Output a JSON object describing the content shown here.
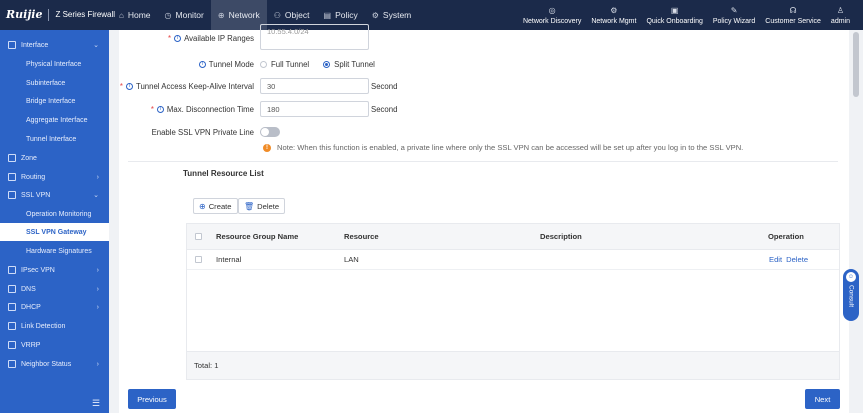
{
  "header": {
    "logo": "Ruijie",
    "series": "Z Series Firewall",
    "nav": [
      {
        "label": "Home",
        "icon": "home-icon"
      },
      {
        "label": "Monitor",
        "icon": "monitor-icon"
      },
      {
        "label": "Network",
        "icon": "network-icon"
      },
      {
        "label": "Object",
        "icon": "object-icon"
      },
      {
        "label": "Policy",
        "icon": "policy-icon"
      },
      {
        "label": "System",
        "icon": "system-icon"
      }
    ],
    "tools": [
      {
        "label": "Network Discovery",
        "icon": "network-discovery-icon"
      },
      {
        "label": "Network Mgmt",
        "icon": "network-mgmt-icon"
      },
      {
        "label": "Quick Onboarding",
        "icon": "quick-onboarding-icon"
      },
      {
        "label": "Policy Wizard",
        "icon": "policy-wizard-icon"
      },
      {
        "label": "Customer Service",
        "icon": "headset-icon"
      },
      {
        "label": "admin",
        "icon": "user-icon"
      }
    ]
  },
  "sidebar": {
    "items": [
      {
        "label": "Interface",
        "level": "top",
        "expanded": true
      },
      {
        "label": "Physical Interface",
        "level": "sub"
      },
      {
        "label": "Subinterface",
        "level": "sub"
      },
      {
        "label": "Bridge Interface",
        "level": "sub"
      },
      {
        "label": "Aggregate Interface",
        "level": "sub"
      },
      {
        "label": "Tunnel Interface",
        "level": "sub"
      },
      {
        "label": "Zone",
        "level": "top"
      },
      {
        "label": "Routing",
        "level": "top",
        "chevron": "right"
      },
      {
        "label": "SSL VPN",
        "level": "top",
        "expanded": true
      },
      {
        "label": "Operation Monitoring",
        "level": "sub"
      },
      {
        "label": "SSL VPN Gateway",
        "level": "sub",
        "active": true
      },
      {
        "label": "Hardware Signatures",
        "level": "sub"
      },
      {
        "label": "IPsec VPN",
        "level": "top",
        "chevron": "right"
      },
      {
        "label": "DNS",
        "level": "top",
        "chevron": "right"
      },
      {
        "label": "DHCP",
        "level": "top",
        "chevron": "right"
      },
      {
        "label": "Link Detection",
        "level": "top"
      },
      {
        "label": "VRRP",
        "level": "top"
      },
      {
        "label": "Neighbor Status",
        "level": "top",
        "chevron": "right"
      }
    ]
  },
  "form": {
    "ip_ranges_label": "Available IP Ranges",
    "ip_ranges_value": "10.55.4.0/24",
    "tunnel_mode_label": "Tunnel Mode",
    "tunnel_mode_options": [
      "Full Tunnel",
      "Split Tunnel"
    ],
    "tunnel_mode_selected": "Split Tunnel",
    "keepalive_label": "Tunnel Access Keep-Alive Interval",
    "keepalive_value": "30",
    "keepalive_unit": "Second",
    "max_disconn_label": "Max. Disconnection Time",
    "max_disconn_value": "180",
    "max_disconn_unit": "Second",
    "private_line_label": "Enable SSL VPN Private Line",
    "private_line_enabled": false,
    "note": "Note: When this function is enabled, a private line where only the SSL VPN can be accessed will be set up after you log in to the SSL VPN."
  },
  "resource_list": {
    "title": "Tunnel Resource List",
    "create_label": "Create",
    "delete_label": "Delete",
    "columns": [
      "Resource Group Name",
      "Resource",
      "Description",
      "Operation"
    ],
    "rows": [
      {
        "group": "Internal",
        "resource": "LAN",
        "description": "",
        "edit": "Edit",
        "delete": "Delete"
      }
    ],
    "total": "Total: 1"
  },
  "footer": {
    "previous_label": "Previous",
    "next_label": "Next"
  },
  "consult_label": "Consult",
  "colors": {
    "topbar": "#1b2a4a",
    "sidebar": "#2c63c6",
    "accent": "#2c63c6",
    "warning": "#f08c28"
  }
}
